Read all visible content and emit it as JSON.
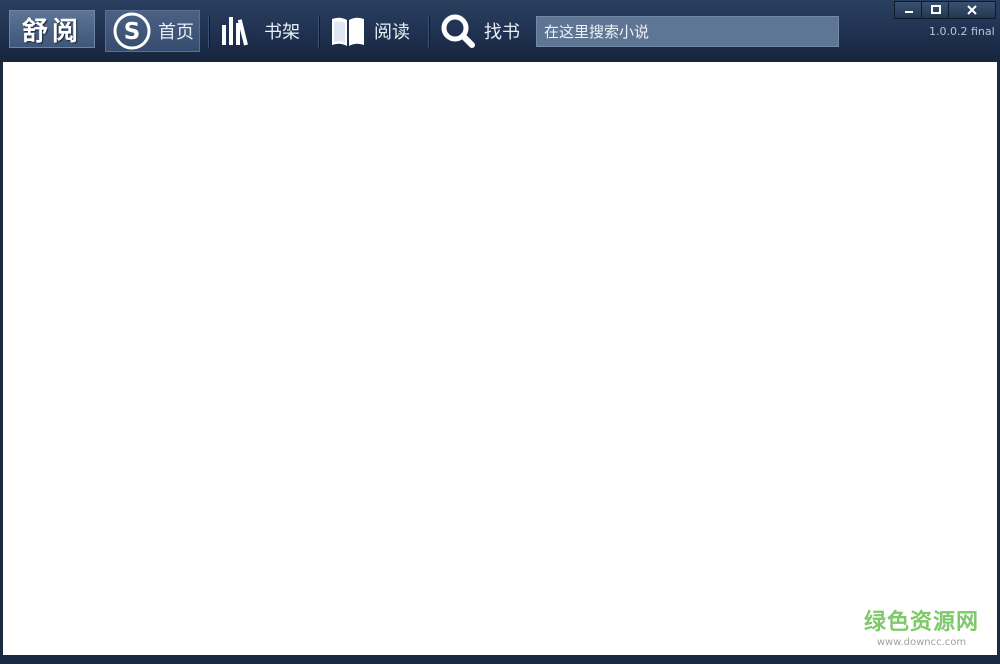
{
  "app": {
    "logo_text": "舒阅",
    "version": "1.0.0.2 final"
  },
  "nav": {
    "home_label": "首页",
    "shelf_label": "书架",
    "read_label": "阅读",
    "find_label": "找书"
  },
  "search": {
    "placeholder": "在这里搜索小说"
  },
  "watermark": {
    "cn": "绿色资源网",
    "en": "www.downcc.com"
  },
  "colors": {
    "accent": "#2a3f5e",
    "content_bg": "#ffffff",
    "watermark": "#7ec96a"
  }
}
